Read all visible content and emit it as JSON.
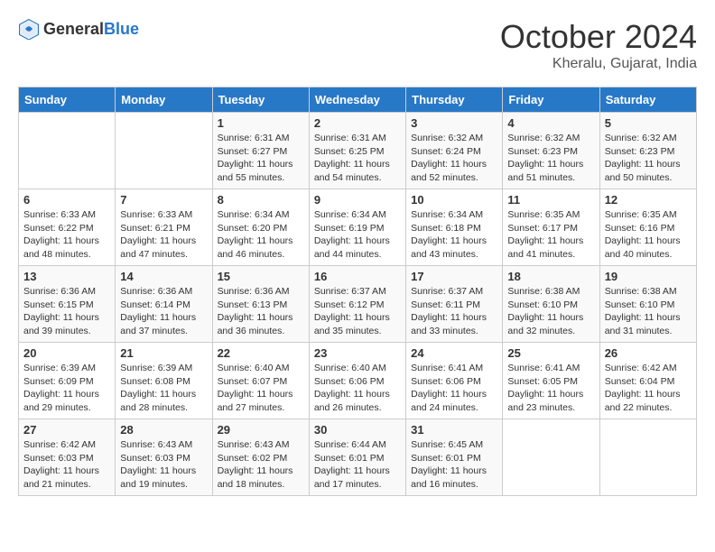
{
  "header": {
    "logo_general": "General",
    "logo_blue": "Blue",
    "month": "October 2024",
    "location": "Kheralu, Gujarat, India"
  },
  "days_of_week": [
    "Sunday",
    "Monday",
    "Tuesday",
    "Wednesday",
    "Thursday",
    "Friday",
    "Saturday"
  ],
  "weeks": [
    [
      {
        "day": "",
        "content": ""
      },
      {
        "day": "",
        "content": ""
      },
      {
        "day": "1",
        "content": "Sunrise: 6:31 AM\nSunset: 6:27 PM\nDaylight: 11 hours and 55 minutes."
      },
      {
        "day": "2",
        "content": "Sunrise: 6:31 AM\nSunset: 6:25 PM\nDaylight: 11 hours and 54 minutes."
      },
      {
        "day": "3",
        "content": "Sunrise: 6:32 AM\nSunset: 6:24 PM\nDaylight: 11 hours and 52 minutes."
      },
      {
        "day": "4",
        "content": "Sunrise: 6:32 AM\nSunset: 6:23 PM\nDaylight: 11 hours and 51 minutes."
      },
      {
        "day": "5",
        "content": "Sunrise: 6:32 AM\nSunset: 6:23 PM\nDaylight: 11 hours and 50 minutes."
      }
    ],
    [
      {
        "day": "6",
        "content": "Sunrise: 6:33 AM\nSunset: 6:22 PM\nDaylight: 11 hours and 48 minutes."
      },
      {
        "day": "7",
        "content": "Sunrise: 6:33 AM\nSunset: 6:21 PM\nDaylight: 11 hours and 47 minutes."
      },
      {
        "day": "8",
        "content": "Sunrise: 6:34 AM\nSunset: 6:20 PM\nDaylight: 11 hours and 46 minutes."
      },
      {
        "day": "9",
        "content": "Sunrise: 6:34 AM\nSunset: 6:19 PM\nDaylight: 11 hours and 44 minutes."
      },
      {
        "day": "10",
        "content": "Sunrise: 6:34 AM\nSunset: 6:18 PM\nDaylight: 11 hours and 43 minutes."
      },
      {
        "day": "11",
        "content": "Sunrise: 6:35 AM\nSunset: 6:17 PM\nDaylight: 11 hours and 41 minutes."
      },
      {
        "day": "12",
        "content": "Sunrise: 6:35 AM\nSunset: 6:16 PM\nDaylight: 11 hours and 40 minutes."
      }
    ],
    [
      {
        "day": "13",
        "content": "Sunrise: 6:36 AM\nSunset: 6:15 PM\nDaylight: 11 hours and 39 minutes."
      },
      {
        "day": "14",
        "content": "Sunrise: 6:36 AM\nSunset: 6:14 PM\nDaylight: 11 hours and 37 minutes."
      },
      {
        "day": "15",
        "content": "Sunrise: 6:36 AM\nSunset: 6:13 PM\nDaylight: 11 hours and 36 minutes."
      },
      {
        "day": "16",
        "content": "Sunrise: 6:37 AM\nSunset: 6:12 PM\nDaylight: 11 hours and 35 minutes."
      },
      {
        "day": "17",
        "content": "Sunrise: 6:37 AM\nSunset: 6:11 PM\nDaylight: 11 hours and 33 minutes."
      },
      {
        "day": "18",
        "content": "Sunrise: 6:38 AM\nSunset: 6:10 PM\nDaylight: 11 hours and 32 minutes."
      },
      {
        "day": "19",
        "content": "Sunrise: 6:38 AM\nSunset: 6:10 PM\nDaylight: 11 hours and 31 minutes."
      }
    ],
    [
      {
        "day": "20",
        "content": "Sunrise: 6:39 AM\nSunset: 6:09 PM\nDaylight: 11 hours and 29 minutes."
      },
      {
        "day": "21",
        "content": "Sunrise: 6:39 AM\nSunset: 6:08 PM\nDaylight: 11 hours and 28 minutes."
      },
      {
        "day": "22",
        "content": "Sunrise: 6:40 AM\nSunset: 6:07 PM\nDaylight: 11 hours and 27 minutes."
      },
      {
        "day": "23",
        "content": "Sunrise: 6:40 AM\nSunset: 6:06 PM\nDaylight: 11 hours and 26 minutes."
      },
      {
        "day": "24",
        "content": "Sunrise: 6:41 AM\nSunset: 6:06 PM\nDaylight: 11 hours and 24 minutes."
      },
      {
        "day": "25",
        "content": "Sunrise: 6:41 AM\nSunset: 6:05 PM\nDaylight: 11 hours and 23 minutes."
      },
      {
        "day": "26",
        "content": "Sunrise: 6:42 AM\nSunset: 6:04 PM\nDaylight: 11 hours and 22 minutes."
      }
    ],
    [
      {
        "day": "27",
        "content": "Sunrise: 6:42 AM\nSunset: 6:03 PM\nDaylight: 11 hours and 21 minutes."
      },
      {
        "day": "28",
        "content": "Sunrise: 6:43 AM\nSunset: 6:03 PM\nDaylight: 11 hours and 19 minutes."
      },
      {
        "day": "29",
        "content": "Sunrise: 6:43 AM\nSunset: 6:02 PM\nDaylight: 11 hours and 18 minutes."
      },
      {
        "day": "30",
        "content": "Sunrise: 6:44 AM\nSunset: 6:01 PM\nDaylight: 11 hours and 17 minutes."
      },
      {
        "day": "31",
        "content": "Sunrise: 6:45 AM\nSunset: 6:01 PM\nDaylight: 11 hours and 16 minutes."
      },
      {
        "day": "",
        "content": ""
      },
      {
        "day": "",
        "content": ""
      }
    ]
  ]
}
